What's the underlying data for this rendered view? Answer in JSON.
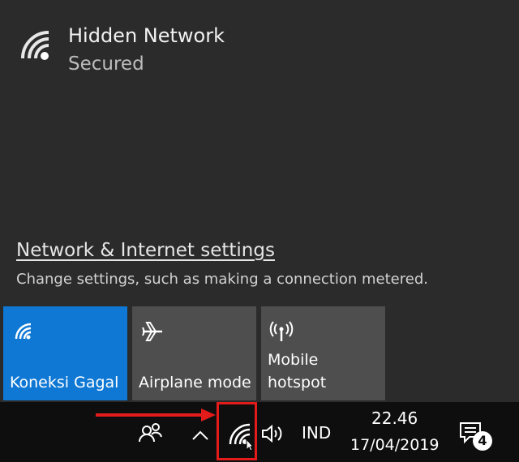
{
  "network": {
    "name": "Hidden Network",
    "status": "Secured",
    "icon": "wifi-icon"
  },
  "settings": {
    "link_label": "Network & Internet settings",
    "description": "Change settings, such as making a connection metered."
  },
  "tiles": [
    {
      "label": "Koneksi Gagal",
      "icon": "wifi-icon",
      "active": true
    },
    {
      "label": "Airplane mode",
      "icon": "airplane-icon",
      "active": false
    },
    {
      "label_line1": "Mobile",
      "label_line2": "hotspot",
      "icon": "hotspot-icon",
      "active": false
    }
  ],
  "taskbar": {
    "language": "IND",
    "time": "22.46",
    "date": "17/04/2019",
    "notification_count": "4",
    "icons": [
      "people-icon",
      "chevron-up-icon",
      "wifi-icon",
      "volume-icon",
      "action-center-icon"
    ]
  },
  "colors": {
    "flyout_bg": "#2b2b2b",
    "tile_active": "#0f78d4",
    "tile_inactive": "#4e4e4e",
    "taskbar_bg": "#0e0e0e",
    "highlight": "#e41b1b"
  }
}
